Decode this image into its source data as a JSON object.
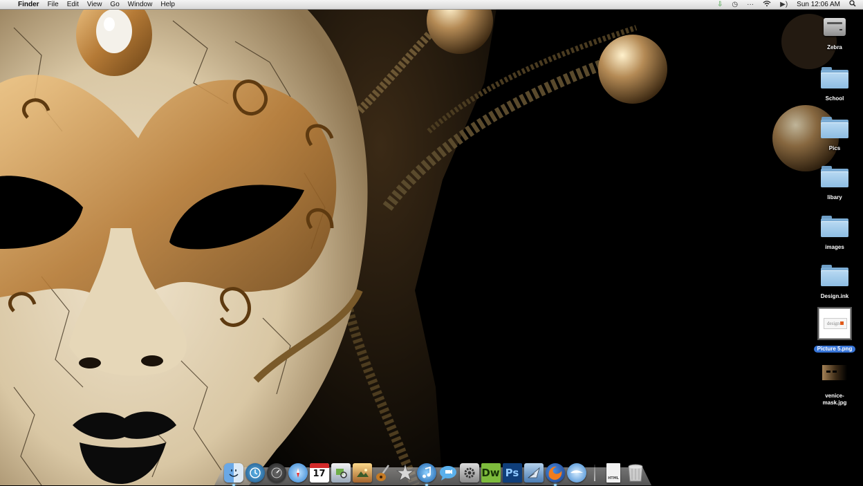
{
  "menubar": {
    "apple_glyph": "",
    "app_name": "Finder",
    "menus": [
      "File",
      "Edit",
      "View",
      "Go",
      "Window",
      "Help"
    ],
    "clock": "Sun 12:06 AM",
    "status_icons": [
      "download-arrow-icon",
      "time-machine-icon",
      "more-icon",
      "wifi-icon",
      "volume-icon",
      "spotlight-icon"
    ]
  },
  "desktop": {
    "items": [
      {
        "label": "Zebra",
        "kind": "hard-disk"
      },
      {
        "label": "School",
        "kind": "folder"
      },
      {
        "label": "Pics",
        "kind": "folder"
      },
      {
        "label": "libary",
        "kind": "folder"
      },
      {
        "label": "images",
        "kind": "folder"
      },
      {
        "label": "Design.ink",
        "kind": "folder"
      },
      {
        "label": "Picture 5.png",
        "kind": "image",
        "selected": true,
        "thumb_text": "design"
      },
      {
        "label": "venice-mask.jpg",
        "kind": "image"
      }
    ]
  },
  "dock": {
    "apps": [
      {
        "name": "Finder",
        "icon": "finder-icon"
      },
      {
        "name": "Time Machine",
        "icon": "time-machine-icon"
      },
      {
        "name": "Dashboard",
        "icon": "dashboard-icon"
      },
      {
        "name": "Safari",
        "icon": "safari-icon"
      },
      {
        "name": "iCal",
        "icon": "calendar-icon",
        "text": "17"
      },
      {
        "name": "Preview",
        "icon": "preview-icon"
      },
      {
        "name": "iPhoto",
        "icon": "iphoto-icon"
      },
      {
        "name": "GarageBand",
        "icon": "garageband-icon"
      },
      {
        "name": "iMovie",
        "icon": "imovie-icon"
      },
      {
        "name": "iTunes",
        "icon": "itunes-icon"
      },
      {
        "name": "iChat",
        "icon": "ichat-icon"
      },
      {
        "name": "System Preferences",
        "icon": "system-preferences-icon"
      },
      {
        "name": "Dreamweaver",
        "icon": "dreamweaver-icon",
        "text": "Dw"
      },
      {
        "name": "Photoshop",
        "icon": "photoshop-icon",
        "text": "Ps"
      },
      {
        "name": "Mail",
        "icon": "mail-icon"
      },
      {
        "name": "Firefox",
        "icon": "firefox-icon"
      },
      {
        "name": "OpenOffice",
        "icon": "openoffice-icon"
      }
    ],
    "stacks": [
      {
        "name": "Document",
        "icon": "document-stack-icon",
        "text": "HTML"
      },
      {
        "name": "Trash",
        "icon": "trash-icon"
      }
    ]
  },
  "colors": {
    "selection": "#3875d7",
    "folder": "#8dbde3",
    "mask_gold": "#b07a34"
  }
}
